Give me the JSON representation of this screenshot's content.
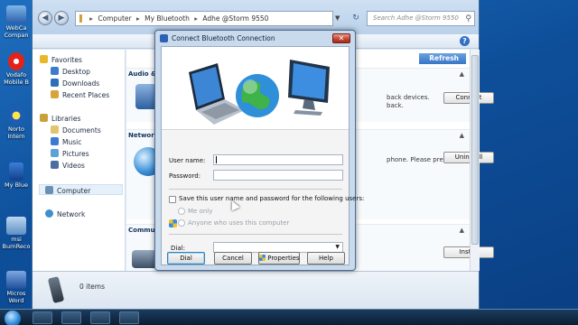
{
  "desktop": {
    "icons": [
      {
        "label1": "WebCa",
        "label2": "Compan"
      },
      {
        "label1": "Vodafo",
        "label2": "Mobile B"
      },
      {
        "label1": "Norto",
        "label2": "Intern"
      },
      {
        "label1": "My Blue",
        "label2": ""
      },
      {
        "label1": "msi",
        "label2": "BurnReco"
      },
      {
        "label1": "Micros",
        "label2": "Word"
      }
    ]
  },
  "explorer": {
    "address": {
      "seg1": "Computer",
      "seg2": "My Bluetooth",
      "seg3": "Adhe @Storm 9550"
    },
    "search_placeholder": "Search Adhe @Storm 9550",
    "nav": {
      "favorites": "Favorites",
      "desktop": "Desktop",
      "downloads": "Downloads",
      "recent": "Recent Places",
      "libraries": "Libraries",
      "documents": "Documents",
      "music": "Music",
      "pictures": "Pictures",
      "videos": "Videos",
      "computer": "Computer",
      "network": "Network"
    },
    "content": {
      "refresh": "Refresh",
      "audio_title": "Audio &",
      "audio_desc1": "back devices.",
      "audio_desc2": "back.",
      "connect_btn": "Connect",
      "network_title": "Network",
      "network_desc": "phone. Please pres",
      "uninstall_btn": "Uninstall",
      "comm_title": "Commun",
      "install_btn": "Install"
    },
    "status": {
      "items": "0 items"
    }
  },
  "dialog": {
    "title": "Connect Bluetooth Connection",
    "username_label": "User name:",
    "username_value": "",
    "password_label": "Password:",
    "password_value": "",
    "save_label": "Save this user name and password for the following users:",
    "me_only": "Me only",
    "anyone": "Anyone who uses this computer",
    "dial_label": "Dial:",
    "dial_value": "",
    "buttons": {
      "dial": "Dial",
      "cancel": "Cancel",
      "properties": "Properties",
      "help": "Help"
    }
  },
  "colors": {
    "accent": "#3775c7",
    "close": "#c4412d"
  }
}
